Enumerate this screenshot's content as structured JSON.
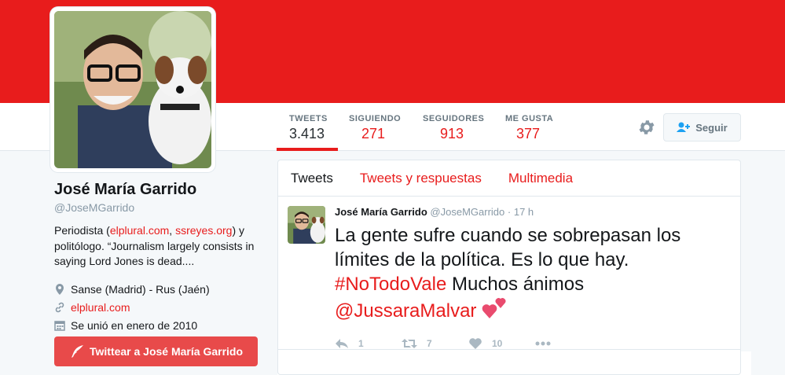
{
  "stats": [
    {
      "label": "TWEETS",
      "value": "3.413"
    },
    {
      "label": "SIGUIENDO",
      "value": "271"
    },
    {
      "label": "SEGUIDORES",
      "value": "913"
    },
    {
      "label": "ME GUSTA",
      "value": "377"
    }
  ],
  "follow_label": "Seguir",
  "profile": {
    "name": "José María Garrido",
    "handle": "@JoseMGarrido",
    "bio_prefix": "Periodista (",
    "bio_link1": "elplural.com",
    "bio_sep": ", ",
    "bio_link2": "ssreyes.org",
    "bio_suffix": ") y politólogo. “Journalism largely consists in saying Lord Jones is dead....",
    "location": "Sanse (Madrid) - Rus (Jaén)",
    "website": "elplural.com",
    "joined": "Se unió en enero de 2010",
    "tweet_to": "Twittear a José María Garrido"
  },
  "tabs": [
    "Tweets",
    "Tweets y respuestas",
    "Multimedia"
  ],
  "tweet": {
    "name": "José María Garrido",
    "handle": "@JoseMGarrido",
    "time": "17 h",
    "text1": "La gente sufre cuando se sobrepasan los límites de la política. Es lo que hay. ",
    "hashtag": "#NoTodoVale",
    "text2": " Muchos ánimos ",
    "mention": "@JussaraMalvar",
    "replies": "1",
    "retweets": "7",
    "likes": "10"
  },
  "colors": {
    "accent": "#e81c1c",
    "banner": "#e81c1c"
  }
}
